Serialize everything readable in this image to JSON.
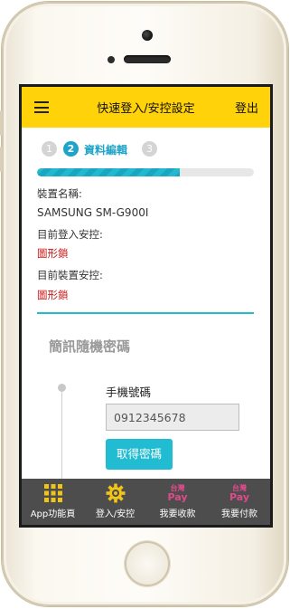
{
  "header": {
    "title": "快速登入/安控設定",
    "logout_label": "登出"
  },
  "steps": [
    {
      "number": "1",
      "label": "",
      "active": false
    },
    {
      "number": "2",
      "label": "資料編輯",
      "active": true
    },
    {
      "number": "3",
      "label": "",
      "active": false
    }
  ],
  "progress": {
    "percent": 66
  },
  "device": {
    "name_label": "裝置名稱:",
    "name_value": "SAMSUNG SM-G900I",
    "login_security_label": "目前登入安控:",
    "login_security_value": "圖形鎖",
    "device_security_label": "目前裝置安控:",
    "device_security_value": "圖形鎖"
  },
  "sms": {
    "section_title": "簡訊隨機密碼",
    "phone_label": "手機號碼",
    "phone_value": "0912345678",
    "get_button_label": "取得密碼"
  },
  "bottom_nav": {
    "items": [
      {
        "label": "App功能頁",
        "icon": "grid-icon"
      },
      {
        "label": "登入/安控",
        "icon": "gear-icon"
      },
      {
        "label": "我要收款",
        "icon": "taiwan-pay-icon",
        "icon_text_top": "台灣",
        "icon_text_bottom": "Pay"
      },
      {
        "label": "我要付款",
        "icon": "taiwan-pay-icon",
        "icon_text_top": "台灣",
        "icon_text_bottom": "Pay"
      }
    ]
  },
  "colors": {
    "header_bg": "#ffd209",
    "accent": "#22bcd2",
    "alert_red": "#cc1a1a",
    "nav_bg": "#4d4d4d",
    "gear_yellow": "#f0c419",
    "pay_pink": "#e04a8c"
  }
}
